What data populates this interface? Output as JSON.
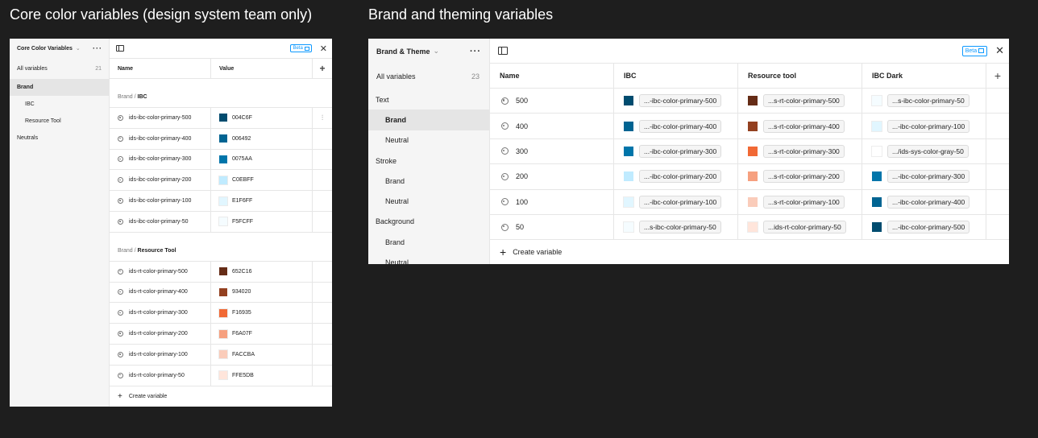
{
  "headings": {
    "core": "Core color variables (design system team only)",
    "brand": "Brand and theming variables"
  },
  "core_panel": {
    "collection": "Core Color Variables",
    "all_variables_label": "All variables",
    "all_variables_count": "21",
    "groups": [
      {
        "label": "Brand",
        "selected": true,
        "indent": 0
      },
      {
        "label": "IBC",
        "selected": false,
        "indent": 1
      },
      {
        "label": "Resource Tool",
        "selected": false,
        "indent": 1
      },
      {
        "label": "Neutrals",
        "selected": false,
        "indent": 0
      }
    ],
    "beta_label": "Beta",
    "columns": {
      "name": "Name",
      "value": "Value"
    },
    "sections": [
      {
        "prefix": "Brand / ",
        "title": "IBC",
        "rows": [
          {
            "name": "ids-ibc-color-primary-500",
            "value": "004C6F",
            "color": "#004C6F"
          },
          {
            "name": "ids-ibc-color-primary-400",
            "value": "006492",
            "color": "#006492"
          },
          {
            "name": "ids-ibc-color-primary-300",
            "value": "0075AA",
            "color": "#0075AA"
          },
          {
            "name": "ids-ibc-color-primary-200",
            "value": "C0EBFF",
            "color": "#C0EBFF"
          },
          {
            "name": "ids-ibc-color-primary-100",
            "value": "E1F6FF",
            "color": "#E1F6FF"
          },
          {
            "name": "ids-ibc-color-primary-50",
            "value": "F5FCFF",
            "color": "#F5FCFF"
          }
        ]
      },
      {
        "prefix": "Brand / ",
        "title": "Resource Tool",
        "rows": [
          {
            "name": "ids-rt-color-primary-500",
            "value": "652C16",
            "color": "#652C16"
          },
          {
            "name": "ids-rt-color-primary-400",
            "value": "934020",
            "color": "#934020"
          },
          {
            "name": "ids-rt-color-primary-300",
            "value": "F16935",
            "color": "#F16935"
          },
          {
            "name": "ids-rt-color-primary-200",
            "value": "F6A07F",
            "color": "#F6A07F"
          },
          {
            "name": "ids-rt-color-primary-100",
            "value": "FACCBA",
            "color": "#FACCBA"
          },
          {
            "name": "ids-rt-color-primary-50",
            "value": "FFE5DB",
            "color": "#FFE5DB"
          }
        ]
      }
    ],
    "create_label": "Create variable"
  },
  "brand_panel": {
    "collection": "Brand & Theme",
    "all_variables_label": "All variables",
    "all_variables_count": "23",
    "groups": [
      {
        "label": "Text",
        "selected": false,
        "indent": 0
      },
      {
        "label": "Brand",
        "selected": true,
        "indent": 1
      },
      {
        "label": "Neutral",
        "selected": false,
        "indent": 1
      },
      {
        "label": "Stroke",
        "selected": false,
        "indent": 0
      },
      {
        "label": "Brand",
        "selected": false,
        "indent": 1
      },
      {
        "label": "Neutral",
        "selected": false,
        "indent": 1
      },
      {
        "label": "Background",
        "selected": false,
        "indent": 0
      },
      {
        "label": "Brand",
        "selected": false,
        "indent": 1
      },
      {
        "label": "Neutral",
        "selected": false,
        "indent": 1
      }
    ],
    "beta_label": "Beta",
    "columns": [
      "Name",
      "IBC",
      "Resource tool",
      "IBC Dark"
    ],
    "rows": [
      {
        "name": "500",
        "cells": [
          {
            "alias": "...-ibc-color-primary-500",
            "color": "#004C6F"
          },
          {
            "alias": "...s-rt-color-primary-500",
            "color": "#652C16"
          },
          {
            "alias": "...s-ibc-color-primary-50",
            "color": "#F5FCFF"
          }
        ]
      },
      {
        "name": "400",
        "cells": [
          {
            "alias": "...-ibc-color-primary-400",
            "color": "#006492"
          },
          {
            "alias": "...s-rt-color-primary-400",
            "color": "#934020"
          },
          {
            "alias": "...-ibc-color-primary-100",
            "color": "#E1F6FF"
          }
        ]
      },
      {
        "name": "300",
        "cells": [
          {
            "alias": "...-ibc-color-primary-300",
            "color": "#0075AA"
          },
          {
            "alias": "...s-rt-color-primary-300",
            "color": "#F16935"
          },
          {
            "alias": ".../ids-sys-color-gray-50",
            "color": "#FFFFFF"
          }
        ]
      },
      {
        "name": "200",
        "cells": [
          {
            "alias": "...-ibc-color-primary-200",
            "color": "#C0EBFF"
          },
          {
            "alias": "...s-rt-color-primary-200",
            "color": "#F6A07F"
          },
          {
            "alias": "...-ibc-color-primary-300",
            "color": "#0075AA"
          }
        ]
      },
      {
        "name": "100",
        "cells": [
          {
            "alias": "...-ibc-color-primary-100",
            "color": "#E1F6FF"
          },
          {
            "alias": "...s-rt-color-primary-100",
            "color": "#FACCBA"
          },
          {
            "alias": "...-ibc-color-primary-400",
            "color": "#006492"
          }
        ]
      },
      {
        "name": "50",
        "cells": [
          {
            "alias": "...s-ibc-color-primary-50",
            "color": "#F5FCFF"
          },
          {
            "alias": "...ids-rt-color-primary-50",
            "color": "#FFE5DB"
          },
          {
            "alias": "...-ibc-color-primary-500",
            "color": "#004C6F"
          }
        ]
      }
    ],
    "create_label": "Create variable"
  },
  "icons": {
    "more": "more-icon",
    "sidebar_toggle": "sidebar-toggle-icon",
    "external_link": "external-link-icon",
    "close": "close-icon",
    "add_column": "plus-icon",
    "variable": "color-variable-icon",
    "edit_row": "adjust-icon"
  },
  "accent_color": "#0D99FF"
}
